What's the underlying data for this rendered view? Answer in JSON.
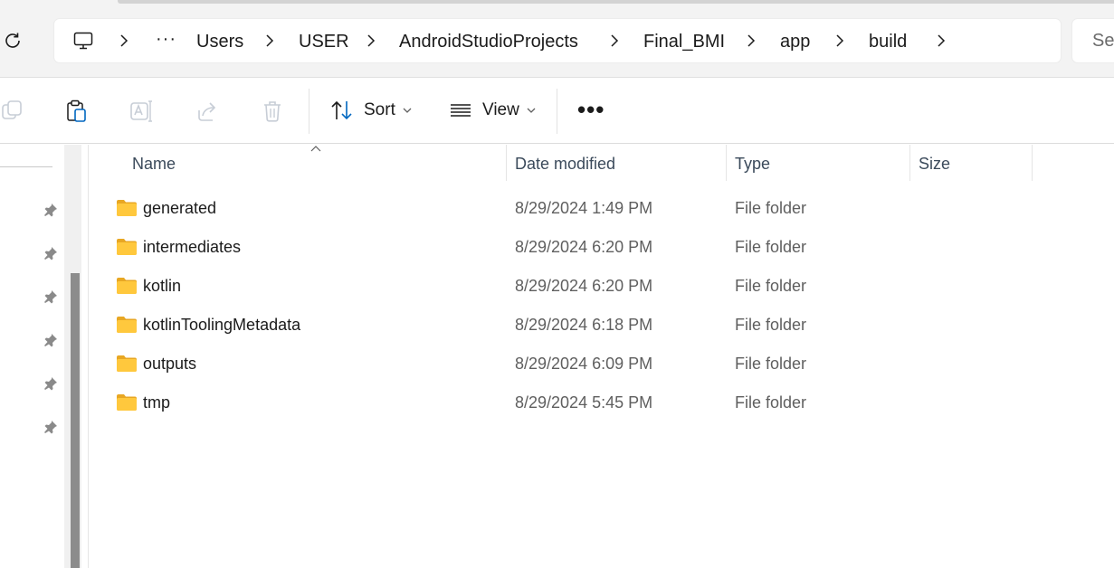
{
  "address_bar": {
    "breadcrumbs": [
      "Users",
      "USER",
      "AndroidStudioProjects",
      "Final_BMI",
      "app",
      "build"
    ],
    "overflow_label": "···",
    "search_placeholder": "Se"
  },
  "toolbar": {
    "sort_label": "Sort",
    "view_label": "View",
    "more_label": "•••"
  },
  "columns": {
    "name": "Name",
    "date_modified": "Date modified",
    "type": "Type",
    "size": "Size"
  },
  "files": [
    {
      "name": "generated",
      "date": "8/29/2024 1:49 PM",
      "type": "File folder",
      "size": ""
    },
    {
      "name": "intermediates",
      "date": "8/29/2024 6:20 PM",
      "type": "File folder",
      "size": ""
    },
    {
      "name": "kotlin",
      "date": "8/29/2024 6:20 PM",
      "type": "File folder",
      "size": ""
    },
    {
      "name": "kotlinToolingMetadata",
      "date": "8/29/2024 6:18 PM",
      "type": "File folder",
      "size": ""
    },
    {
      "name": "outputs",
      "date": "8/29/2024 6:09 PM",
      "type": "File folder",
      "size": ""
    },
    {
      "name": "tmp",
      "date": "8/29/2024 5:45 PM",
      "type": "File folder",
      "size": ""
    }
  ],
  "colors": {
    "accent": "#0067c0",
    "folder": "#ffc83d",
    "folder_dark": "#e8a723",
    "scroll_thumb": "#8c8c8c"
  },
  "icons": {
    "refresh": "refresh-icon",
    "this_pc": "monitor-icon",
    "copy": "copy-icon",
    "paste": "paste-icon",
    "rename": "rename-icon",
    "share": "share-icon",
    "delete": "trash-icon",
    "sort": "sort-icon",
    "view": "view-list-icon",
    "folder": "folder-icon",
    "pin": "pin-icon"
  }
}
